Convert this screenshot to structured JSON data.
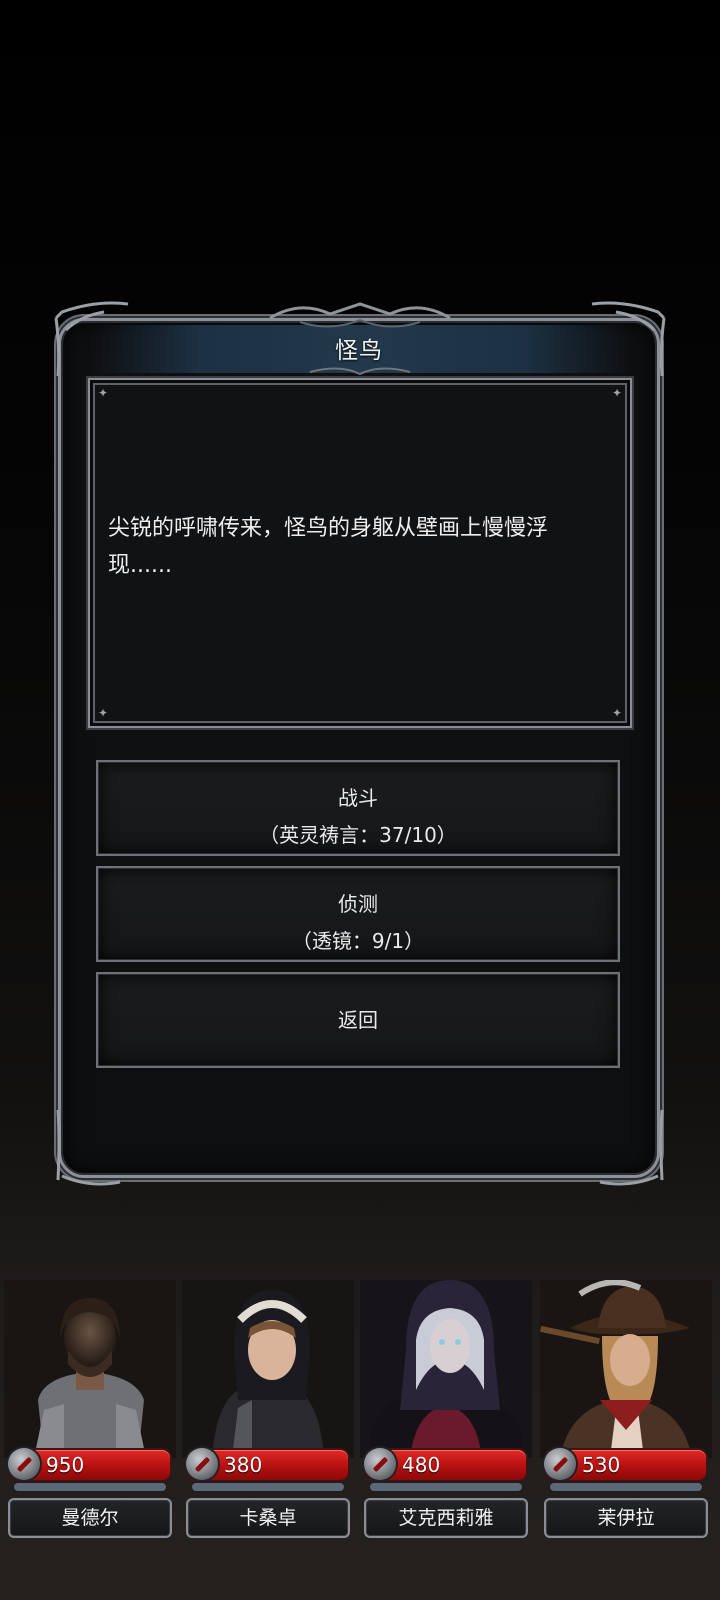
{
  "dialog": {
    "title": "怪鸟",
    "story": "尖锐的呼啸传来，怪鸟的身躯从壁画上慢慢浮现......",
    "options": [
      {
        "label": "战斗",
        "cost": "（英灵祷言：37/10）"
      },
      {
        "label": "侦测",
        "cost": "（透镜：9/1）"
      },
      {
        "label": "返回"
      }
    ]
  },
  "party": [
    {
      "name": "曼德尔",
      "hp": "950",
      "hp_fraction": 1.0
    },
    {
      "name": "卡桑卓",
      "hp": "380",
      "hp_fraction": 1.0
    },
    {
      "name": "艾克西莉雅",
      "hp": "480",
      "hp_fraction": 1.0
    },
    {
      "name": "茉伊拉",
      "hp": "530",
      "hp_fraction": 1.0
    }
  ],
  "colors": {
    "hp_bar": "#c4161a",
    "frame": "#8d9197",
    "title_band": "#22394c"
  }
}
